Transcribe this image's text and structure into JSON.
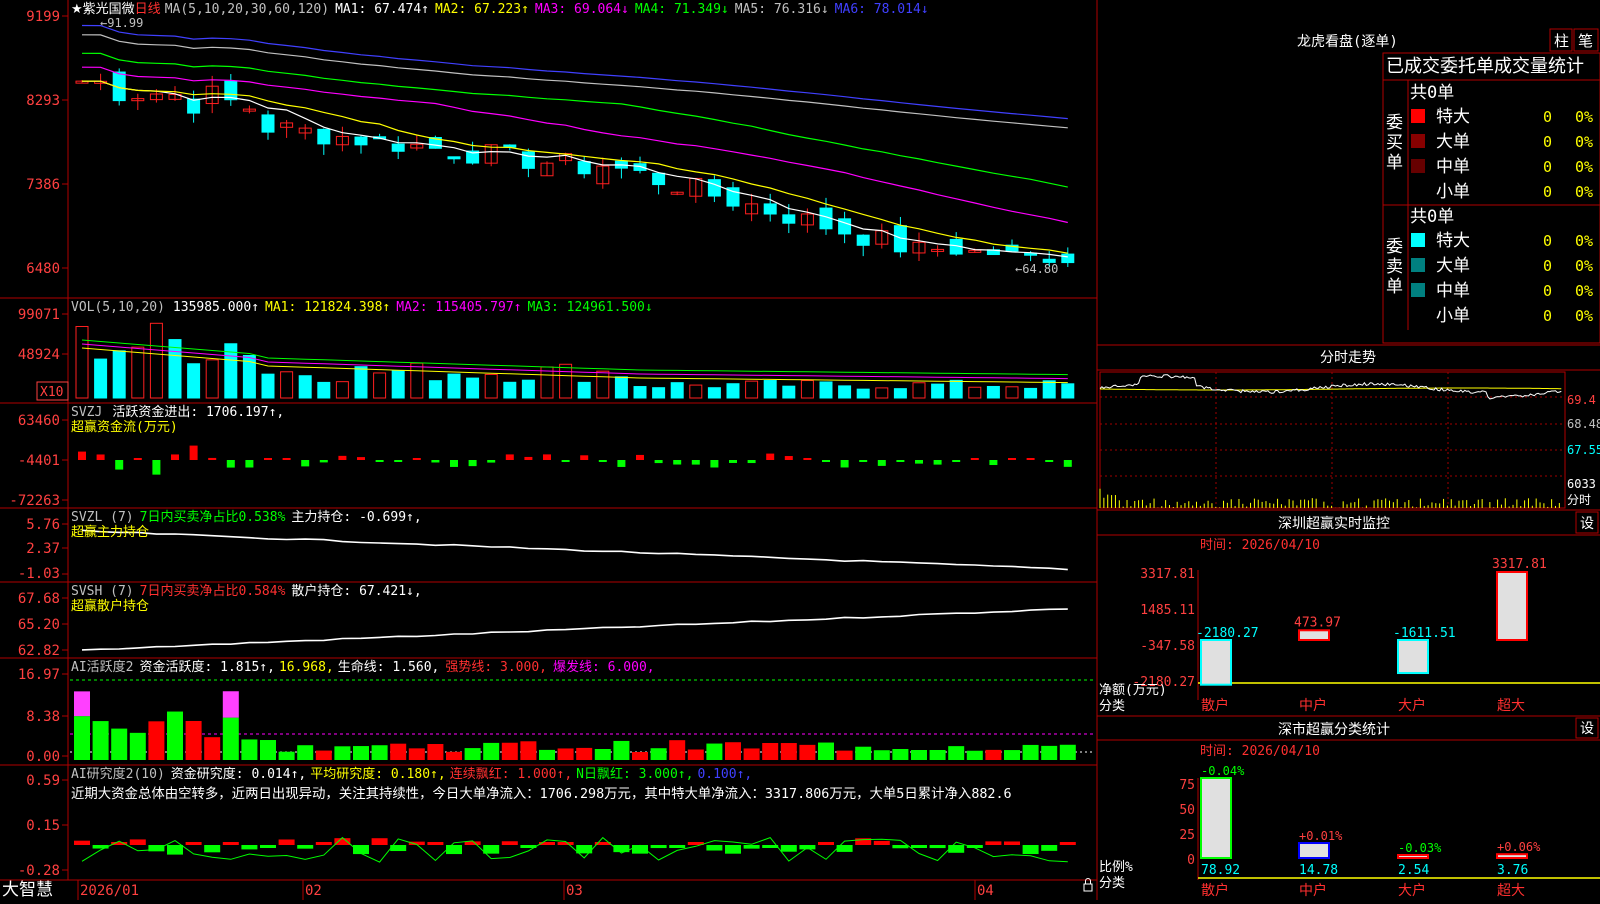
{
  "app": {
    "brand": "大智慧"
  },
  "stock": {
    "name": "紫光国微",
    "period": "日线"
  },
  "colors": {
    "up": "#ff2020",
    "down": "#00ffff",
    "ma1": "#ffffff",
    "ma2": "#ffff00",
    "ma3": "#ff00ff",
    "ma4": "#00ff00",
    "ma5": "#c0c0c0",
    "ma6": "#4040ff",
    "grid": "#a00000",
    "bg": "#000000"
  },
  "main_panel": {
    "legend": {
      "title": "MA(5,10,20,30,60,120)",
      "ma1": "MA1: 67.474↑",
      "ma2": "MA2: 67.223↑",
      "ma3": "MA3: 69.064↓",
      "ma4": "MA4: 71.349↓",
      "ma5": "MA5: 76.316↓",
      "ma6": "MA6: 78.014↓"
    },
    "y_ticks": [
      "9199",
      "8293",
      "7386",
      "6480"
    ],
    "high_label": "91.99",
    "low_label": "64.80"
  },
  "vol_panel": {
    "legend": {
      "title": "VOL(5,10,20)",
      "value": "135985.000↑",
      "ma1": "MA1: 121824.398↑",
      "ma2": "MA2: 115405.797↑",
      "ma3": "MA3: 124961.500↓"
    },
    "y_ticks": [
      "99071",
      "48924"
    ],
    "unit": "X10"
  },
  "svzj_panel": {
    "legend": {
      "title": "SVZJ",
      "text": "活跃资金进出: 1706.197↑,",
      "sub": "超赢资金流(万元)"
    },
    "y_ticks": [
      "63460",
      "-4401",
      "-72263"
    ]
  },
  "svzl_panel": {
    "legend": {
      "title": "SVZL (7)",
      "ratio": "7日内买卖净占比0.538%",
      "text": "主力持仓: -0.699↑,",
      "sub": "超赢主力持仓"
    },
    "y_ticks": [
      "5.76",
      "2.37",
      "-1.03"
    ]
  },
  "svsh_panel": {
    "legend": {
      "title": "SVSH (7)",
      "ratio": "7日内买卖净占比0.584%",
      "text": "散户持仓: 67.421↓,",
      "sub": "超赢散户持仓"
    },
    "y_ticks": [
      "67.68",
      "65.20",
      "62.82"
    ]
  },
  "ai_active_panel": {
    "legend": {
      "title": "AI活跃度2",
      "a": "资金活跃度: 1.815↑,",
      "b": "16.968,",
      "c": "生命线: 1.560,",
      "d": "强势线: 3.000,",
      "e": "爆发线: 6.000,"
    },
    "y_ticks": [
      "16.97",
      "8.38",
      "0.00"
    ]
  },
  "ai_research_panel": {
    "legend": {
      "title": "AI研究度2(10)",
      "a": "资金研究度: 0.014↑,",
      "b": "平均研究度: 0.180↑,",
      "c": "连续飘红: 1.000↑,",
      "d": "N日飘红: 3.000↑,",
      "e": "0.100↑,"
    },
    "comment": "近期大资金总体由空转多，近两日出现异动，关注其持续性，今日大单净流入：1706.298万元，其中特大单净流入：3317.806万元，大单5日累计净入882.6",
    "y_ticks": [
      "0.59",
      "0.15",
      "-0.28"
    ]
  },
  "x_axis": {
    "labels": [
      "2026/01",
      "02",
      "03",
      "04"
    ]
  },
  "dragon_tiger": {
    "title": "龙虎看盘(逐单)",
    "btn1": "柱",
    "btn2": "笔",
    "subtitle": "已成交委托单成交量统计",
    "buy": {
      "side": "委买单",
      "total": "共0单",
      "rows": [
        {
          "label": "特大",
          "count": "0",
          "pct": "0%",
          "color": "#ff0000"
        },
        {
          "label": "大单",
          "count": "0",
          "pct": "0%",
          "color": "#880000"
        },
        {
          "label": "中单",
          "count": "0",
          "pct": "0%",
          "color": "#660000"
        },
        {
          "label": "小单",
          "count": "0",
          "pct": "0%",
          "color": ""
        }
      ]
    },
    "sell": {
      "side": "委卖单",
      "total": "共0单",
      "rows": [
        {
          "label": "特大",
          "count": "0",
          "pct": "0%",
          "color": "#00ffff"
        },
        {
          "label": "大单",
          "count": "0",
          "pct": "0%",
          "color": "#008080"
        },
        {
          "label": "中单",
          "count": "0",
          "pct": "0%",
          "color": "#008080"
        },
        {
          "label": "小单",
          "count": "0",
          "pct": "0%",
          "color": ""
        }
      ]
    }
  },
  "intraday": {
    "title": "分时走势",
    "y_ticks": [
      "69.4",
      "68.48",
      "67.55",
      "6033",
      "分时"
    ]
  },
  "sz_monitor": {
    "title": "深圳超赢实时监控",
    "settings": "设",
    "date": "时间: 2026/04/10",
    "y_ticks": [
      "3317.81",
      "1485.11",
      "-347.58",
      "-2180.27"
    ],
    "ylabel": "净额(万元)",
    "xlabel": "分类",
    "categories": [
      "散户",
      "中户",
      "大户",
      "超大"
    ],
    "values": [
      -2180.27,
      473.97,
      -1611.51,
      3317.81
    ],
    "labels": [
      "-2180.27",
      "473.97",
      "-1611.51",
      "3317.81"
    ]
  },
  "sz_category": {
    "title": "深市超赢分类统计",
    "settings": "设",
    "date": "时间: 2026/04/10",
    "y_ticks": [
      "75",
      "50",
      "25",
      "0"
    ],
    "ylabel": "比例%",
    "xlabel": "分类",
    "categories": [
      "散户",
      "中户",
      "大户",
      "超大"
    ],
    "ratios": [
      78.92,
      14.78,
      2.54,
      3.76
    ],
    "ratio_labels": [
      "78.92",
      "14.78",
      "2.54",
      "3.76"
    ],
    "changes": [
      "-0.04%",
      "+0.01%",
      "-0.03%",
      "+0.06%"
    ]
  }
}
